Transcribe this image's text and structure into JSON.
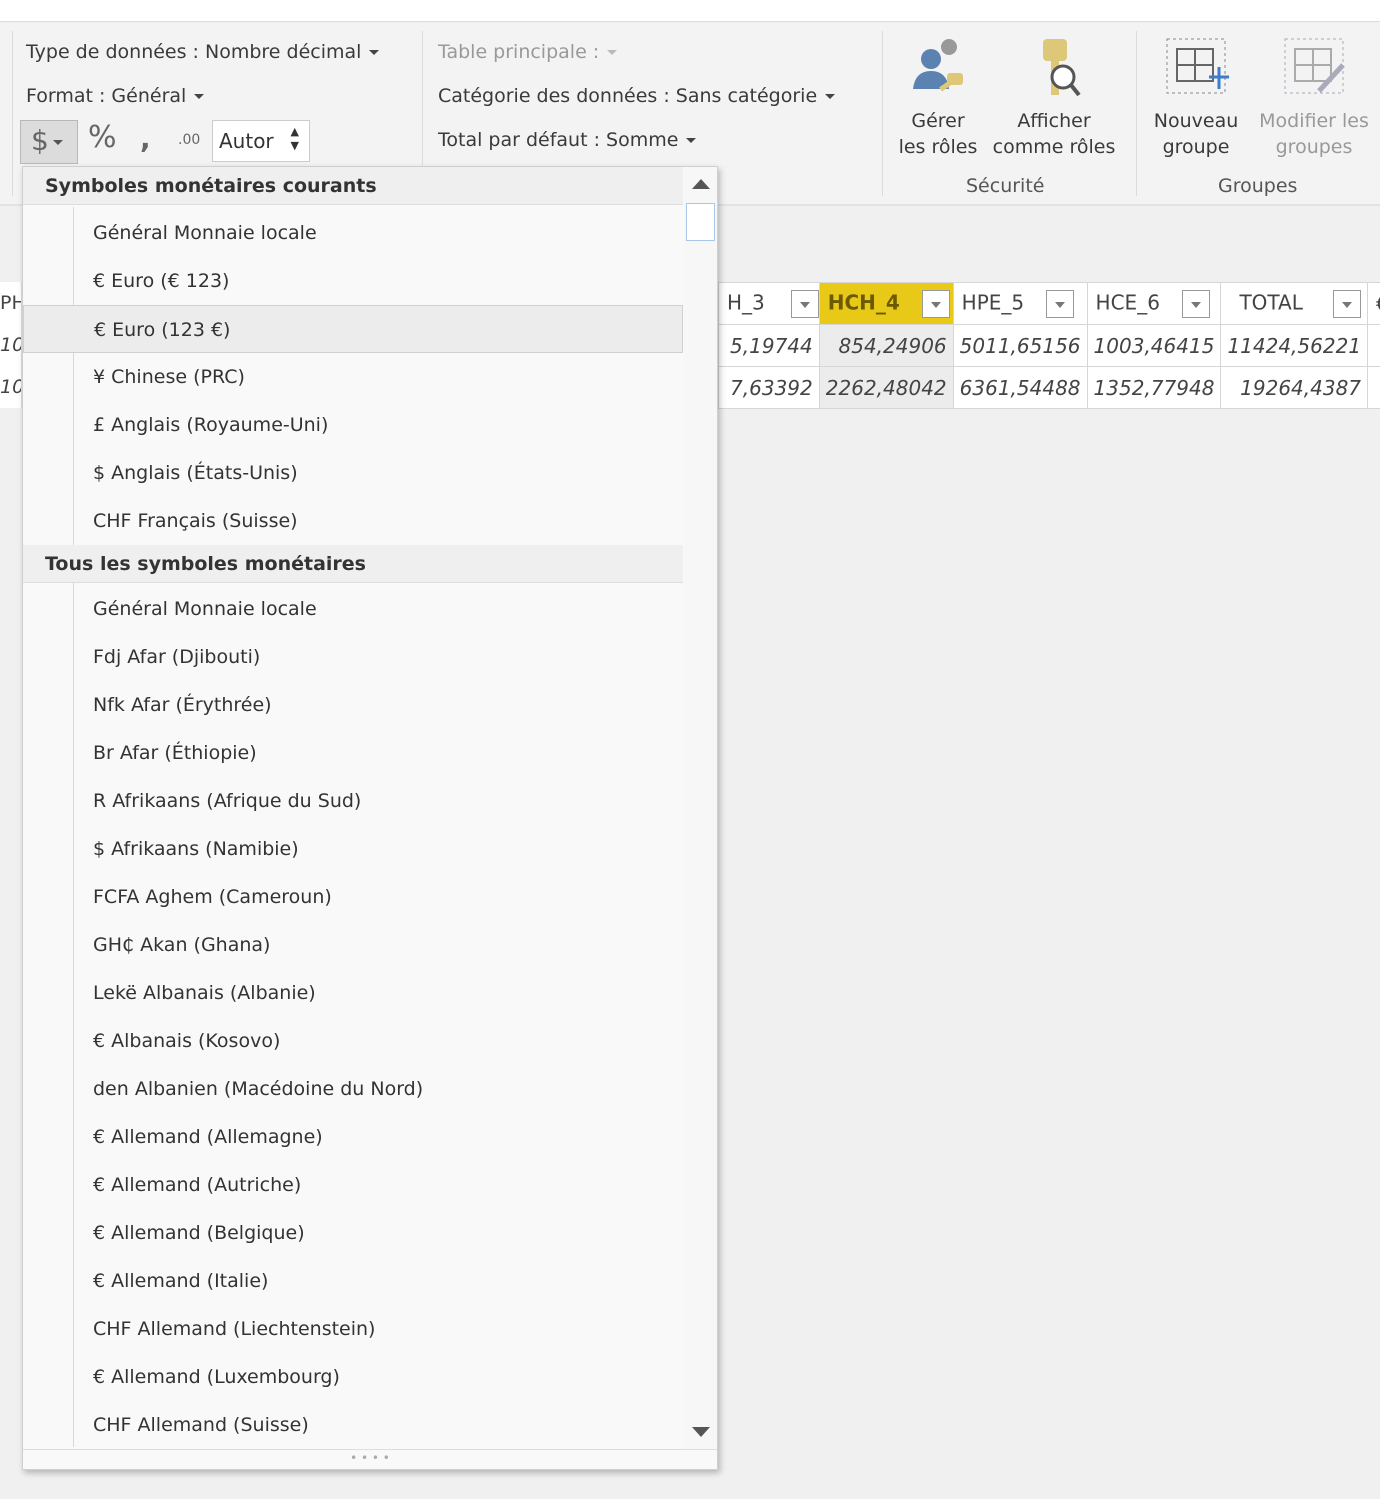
{
  "ribbon": {
    "data_type": "Type de données : Nombre décimal",
    "format": "Format : Général",
    "currency_symbol": "$",
    "percent_symbol": "%",
    "comma_symbol": ",",
    "decimals_symbol": ".00",
    "decimal_places_value": "Autor",
    "main_table": "Table principale :",
    "data_category": "Catégorie des données : Sans catégorie",
    "default_summary": "Total par défaut : Somme",
    "security": {
      "manage_roles": [
        "Gérer",
        "les rôles"
      ],
      "view_as": [
        "Afficher",
        "comme rôles"
      ],
      "label": "Sécurité"
    },
    "groups": {
      "new_group": [
        "Nouveau",
        "groupe"
      ],
      "edit_groups": [
        "Modifier les",
        "groupes"
      ],
      "label": "Groupes"
    }
  },
  "table": {
    "left_fragment": {
      "header": "PH",
      "rows": [
        "10",
        "10"
      ]
    },
    "columns": [
      "H_3",
      "HCH_4",
      "HPE_5",
      "HCE_6",
      "TOTAL",
      "€"
    ],
    "rows": [
      [
        "5,19744",
        "854,24906",
        "5011,65156",
        "1003,46415",
        "11424,56221",
        ""
      ],
      [
        "7,63392",
        "2262,48042",
        "6361,54488",
        "1352,77948",
        "19264,4387",
        ""
      ]
    ],
    "selected_column": "HCH_4",
    "highlight_color": "#e8c918"
  },
  "dropdown": {
    "common_header": "Symboles monétaires courants",
    "common_items": [
      "Général Monnaie locale",
      "€ Euro (€ 123)",
      "€ Euro (123 €)",
      "¥ Chinese (PRC)",
      "£ Anglais (Royaume-Uni)",
      "$ Anglais (États-Unis)",
      "CHF Français (Suisse)"
    ],
    "highlighted_item": "€ Euro (123 €)",
    "all_header": "Tous les symboles monétaires",
    "all_items": [
      "Général Monnaie locale",
      "Fdj Afar (Djibouti)",
      "Nfk Afar (Érythrée)",
      "Br Afar (Éthiopie)",
      "R Afrikaans (Afrique du Sud)",
      "$ Afrikaans (Namibie)",
      "FCFA Aghem (Cameroun)",
      "GH₵ Akan (Ghana)",
      "Lekë Albanais (Albanie)",
      "€ Albanais (Kosovo)",
      "den Albanien (Macédoine du Nord)",
      "€ Allemand (Allemagne)",
      "€ Allemand (Autriche)",
      "€ Allemand (Belgique)",
      "€ Allemand (Italie)",
      "CHF Allemand (Liechtenstein)",
      "€ Allemand (Luxembourg)",
      "CHF Allemand (Suisse)"
    ]
  }
}
